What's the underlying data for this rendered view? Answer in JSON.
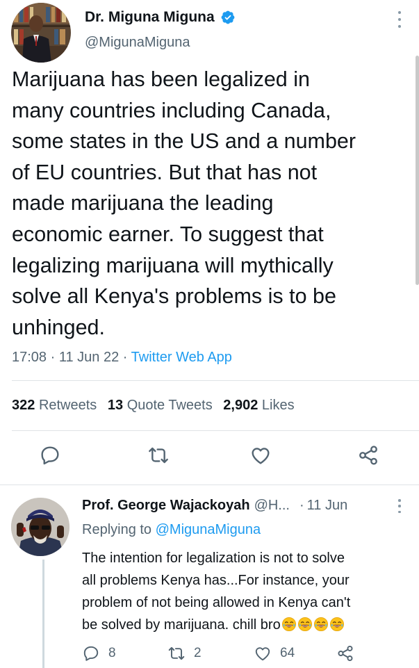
{
  "main_tweet": {
    "author_name": "Dr. Miguna Miguna",
    "author_handle": "@MigunaMiguna",
    "body_lines": [
      "Marijuana has been legalized in",
      "many countries including Canada,",
      "some states in the US and a number",
      "of EU countries. But that has not",
      "made marijuana the leading",
      "economic earner. To suggest that",
      "legalizing marijuana will mythically",
      "solve all Kenya's problems is to be",
      "unhinged."
    ],
    "time": "17:08",
    "date": "11 Jun 22",
    "separator": "·",
    "source": "Twitter Web App",
    "stats": {
      "retweets_count": "322",
      "retweets_label": "Retweets",
      "quotes_count": "13",
      "quotes_label": "Quote Tweets",
      "likes_count": "2,902",
      "likes_label": "Likes"
    }
  },
  "reply_tweet": {
    "author_name": "Prof. George Wajackoyah",
    "author_handle": "@H...",
    "separator": "·",
    "date": "11 Jun",
    "replying_label": "Replying to",
    "replying_mention": "@MigunaMiguna",
    "body_lines": [
      "The intention for legalization is not to solve",
      "all problems Kenya has...For instance, your",
      "problem of not being allowed in Kenya can't",
      "be solved by marijuana. chill bro"
    ],
    "emoji_count": 4,
    "counts": {
      "replies": "8",
      "retweets": "2",
      "likes": "64"
    }
  },
  "colors": {
    "accent": "#1d9bf0",
    "secondary_text": "#536471",
    "primary_text": "#0f1419",
    "divider": "#dfe3e6"
  },
  "icons": [
    "verified-badge-icon",
    "more-icon",
    "reply-icon",
    "retweet-icon",
    "like-icon",
    "share-icon",
    "laughing-emoji-icon"
  ]
}
